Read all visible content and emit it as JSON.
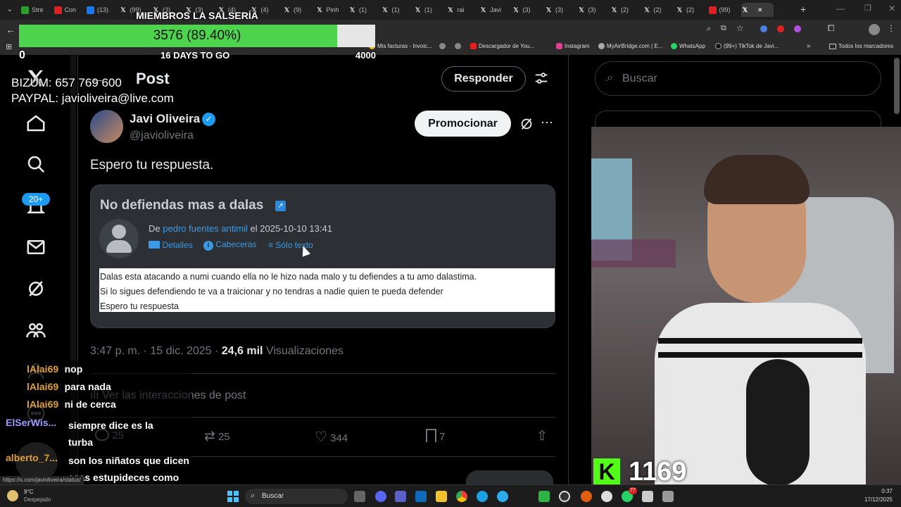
{
  "browser": {
    "tabs": [
      "Stre",
      "Con",
      "(13)",
      "(99)",
      "(3)",
      "(3)",
      "(4)",
      "(4)",
      "(9)",
      "Pinh",
      "(1)",
      "(1)",
      "(1)",
      "rai",
      "Javi",
      "(3)",
      "(3)",
      "(3)",
      "(2)",
      "(2)",
      "(2)",
      "(99)"
    ],
    "bookmarks": [
      "Mis facturas - Invoic...",
      "Descargador de You...",
      "Instagram",
      "MyAirBridge.com | E...",
      "WhatsApp",
      "(99+) TikTok de Javi...",
      "Todos los marcadores"
    ],
    "status_url": "https://x.com/javioliveira/status/"
  },
  "overlay": {
    "goal_title": "MIEMBROS LA SALSERÍA",
    "goal_value": "3576 (89.40%)",
    "goal_progress": 0.894,
    "goal_min": "0",
    "goal_max": "4000",
    "goal_days": "16 DAYS TO GO",
    "bizum": "BIZUM: 657 769 600",
    "paypal": "PAYPAL: javioliveira@live.com",
    "kick_count": "1169",
    "chat": [
      {
        "user": "lAlai69",
        "msg": "nop",
        "color": "#e0a030"
      },
      {
        "user": "lAlai69",
        "msg": "para nada",
        "color": "#e0a030"
      },
      {
        "user": "lAlai69",
        "msg": "ni de cerca",
        "color": "#e0a030"
      },
      {
        "user": "ElSerWis...",
        "msg": "siempre dice es la turba",
        "color": "#9b9bff"
      },
      {
        "user": "alberto_7...",
        "msg": "son los niñatos que dicen esas estupideces como los fans de guibel",
        "color": "#e0a030"
      }
    ]
  },
  "x": {
    "header_title": "Post",
    "reply_button": "Responder",
    "search_placeholder": "Buscar",
    "notif_badge": "20+",
    "author_name": "Javi Oliveira",
    "author_handle": "@javioliveira",
    "promote_button": "Promocionar",
    "post_text": "Espero tu respuesta.",
    "email": {
      "subject": "No defiendas mas a dalas",
      "from_prefix": "De",
      "sender": "pedro fuentes antimil",
      "date": "el 2025-10-10 13:41",
      "links": [
        "Detalles",
        "Cabeceras",
        "Sólo texto"
      ],
      "body": [
        "Dalas esta atacando a numi cuando ella no le hizo nada malo y tu defiendes a tu amo dalastima.",
        "Si lo sigues defendiendo te va a traicionar y no tendras a nadie quien te pueda defender",
        "Espero tu respuesta"
      ]
    },
    "timestamp": "3:47 p. m. · 15 dic. 2025 ·",
    "views_count": "24,6 mil",
    "views_label": "Visualizaciones",
    "interactions_link": "Ver las interacciones de post",
    "replies": "25",
    "reposts": "25",
    "likes": "344",
    "bookmarks": "7"
  },
  "taskbar": {
    "weather_temp": "9°C",
    "weather_desc": "Despejado",
    "search": "Buscar",
    "time": "0:37",
    "date": "17/12/2025",
    "notif_count": "77"
  },
  "colors": {
    "accent": "#1d9bf0",
    "goal_fill": "#4cd44c",
    "kick_green": "#53fc18"
  }
}
